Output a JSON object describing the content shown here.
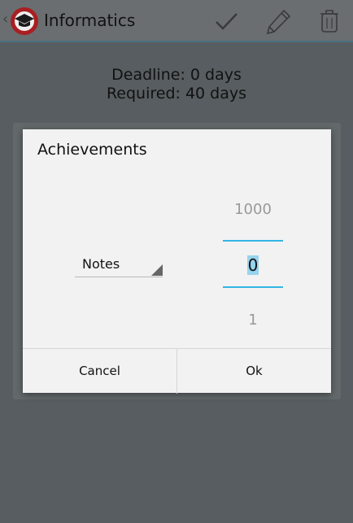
{
  "action_bar": {
    "title": "Informatics",
    "up_glyph": "‹",
    "app_icon": "graduation-cap-icon",
    "actions": [
      "check-icon",
      "pencil-icon",
      "trash-icon"
    ]
  },
  "info": {
    "deadline": "Deadline: 0 days",
    "required": "Required: 40 days"
  },
  "dialog": {
    "title": "Achievements",
    "spinner_value": "Notes",
    "picker": {
      "above": "1000",
      "current": "0",
      "below": "1"
    },
    "cancel_label": "Cancel",
    "ok_label": "Ok"
  },
  "colors": {
    "accent": "#33b5e5",
    "app_icon_red": "#a91f22"
  }
}
